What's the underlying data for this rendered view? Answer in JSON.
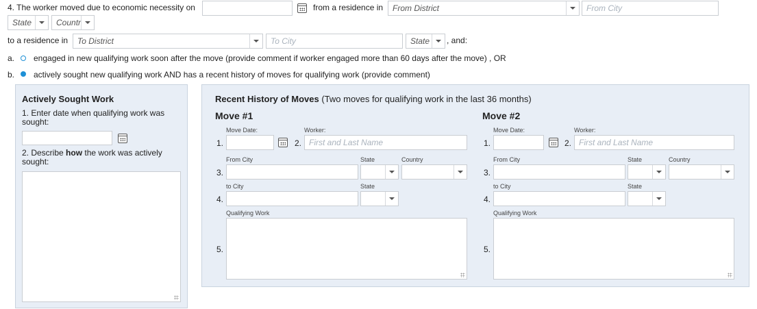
{
  "question": {
    "prefix": "4. The worker moved due to economic necessity on",
    "from_residence": "from a residence in",
    "from_district": "From District",
    "from_city_placeholder": "From City",
    "state": "State",
    "country": "Countr",
    "to_residence": "to a residence in",
    "to_district": "To District",
    "to_city_placeholder": "To City",
    "to_state": "State",
    "and": ", and:"
  },
  "options": {
    "a_marker": "a.",
    "a_text": "engaged in new qualifying work soon after the move (provide comment if worker engaged more than 60 days after the move) , OR",
    "b_marker": "b.",
    "b_text": "actively sought new qualifying work AND has a recent history of moves for qualifying work (provide comment)",
    "selected": "b"
  },
  "sought": {
    "title": "Actively Sought Work",
    "q1": "1. Enter date when qualifying work was sought:",
    "q2_pre": "2. Describe ",
    "q2_bold": "how",
    "q2_post": " the work was actively sought:"
  },
  "history": {
    "title": "Recent History of Moves",
    "subtitle": "(Two moves for qualifying work in the last 36 months)",
    "labels": {
      "move_date": "Move Date:",
      "worker": "Worker:",
      "worker_placeholder": "First and Last Name",
      "from_city": "From City",
      "state": "State",
      "country": "Country",
      "to_city": "to City",
      "qualifying_work": "Qualifying Work",
      "n1": "1.",
      "n2": "2.",
      "n3": "3.",
      "n4": "4.",
      "n5": "5."
    },
    "move1_title": "Move #1",
    "move2_title": "Move #2"
  }
}
